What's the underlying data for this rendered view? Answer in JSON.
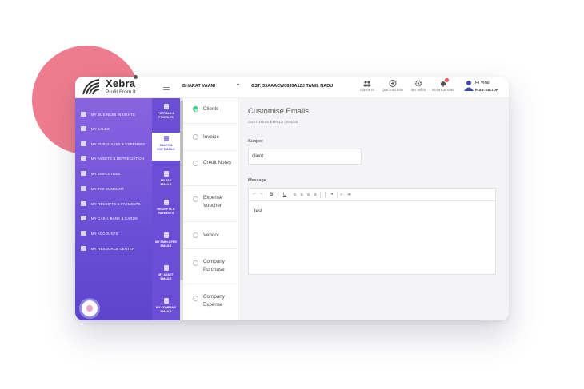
{
  "colors": {
    "accent": "#6a4fd6",
    "success": "#3ec98e",
    "deco_circle": "#ee7c8e"
  },
  "app": {
    "logo_name": "Xebra",
    "logo_tagline": "Profit From It"
  },
  "header": {
    "company": "BHARAT VAANI",
    "gst": "GST: 33AAACW0835A1ZJ TAMIL NADU",
    "actions": [
      {
        "label": "COHORTS",
        "icon": "users-icon"
      },
      {
        "label": "QUICK ACTION",
        "icon": "plus-circle-icon"
      },
      {
        "label": "SETTINGS",
        "icon": "gear-icon"
      },
      {
        "label": "NOTIFICATIONS",
        "icon": "bell-icon"
      }
    ],
    "user_greeting": "Hi Viral",
    "user_plan": "PLAN: GALLOP"
  },
  "sidebar": {
    "items": [
      {
        "label": "MY BUSINESS INSIGHTS"
      },
      {
        "label": "MY SALES"
      },
      {
        "label": "MY PURCHASES & EXPENSES"
      },
      {
        "label": "MY ASSETS & DEPRECIATION"
      },
      {
        "label": "MY EMPLOYEES"
      },
      {
        "label": "MY TAX SUMMARY"
      },
      {
        "label": "MY RECEIPTS & PAYMENTS"
      },
      {
        "label": "MY CASH, BANK & CARDS"
      },
      {
        "label": "MY ACCOUNTS"
      },
      {
        "label": "MY RESOURCE CENTER"
      }
    ]
  },
  "subnav": {
    "items": [
      {
        "line1": "PORTALS &",
        "line2": "PROFILES"
      },
      {
        "line1": "SALES &",
        "line2": "EXP EMAILS"
      },
      {
        "line1": "MY TAX",
        "line2": "EMAILS"
      },
      {
        "line1": "RECEIPTS &",
        "line2": "PAYMENTS"
      },
      {
        "line1": "MY EMPLOYEE",
        "line2": "EMAILS"
      },
      {
        "line1": "MY ASSET",
        "line2": "EMAILS"
      },
      {
        "line1": "MY COMPANY",
        "line2": "EMAILS"
      }
    ],
    "active_index": 1
  },
  "options": {
    "items": [
      {
        "label": "Clients"
      },
      {
        "label": "Invoice"
      },
      {
        "label": "Credit Notes"
      },
      {
        "label": "Expense Voucher"
      },
      {
        "label": "Vendor"
      },
      {
        "label": "Company Purchase"
      },
      {
        "label": "Company Expense"
      }
    ],
    "selected_index": 0
  },
  "main": {
    "title": "Customise Emails",
    "breadcrumb": "CUSTOMISE EMAILS / SALES",
    "subject_label": "Subject",
    "subject_value": "client",
    "message_label": "Message",
    "message_value": "test",
    "toolbar": [
      {
        "glyph": "↶",
        "icon": "undo-icon"
      },
      {
        "glyph": "↷",
        "icon": "redo-icon"
      },
      {
        "glyph": "B",
        "icon": "bold-icon"
      },
      {
        "glyph": "I",
        "icon": "italic-icon"
      },
      {
        "glyph": "U",
        "icon": "underline-icon"
      },
      {
        "glyph": "≡",
        "icon": "align-left-icon"
      },
      {
        "glyph": "≡",
        "icon": "align-center-icon"
      },
      {
        "glyph": "≡",
        "icon": "align-right-icon"
      },
      {
        "glyph": "≡",
        "icon": "align-justify-icon"
      },
      {
        "glyph": "⋮",
        "icon": "ordered-list-icon"
      },
      {
        "glyph": "•",
        "icon": "bullet-list-icon"
      },
      {
        "glyph": "⇤",
        "icon": "outdent-icon"
      },
      {
        "glyph": "⇥",
        "icon": "indent-icon"
      }
    ]
  }
}
